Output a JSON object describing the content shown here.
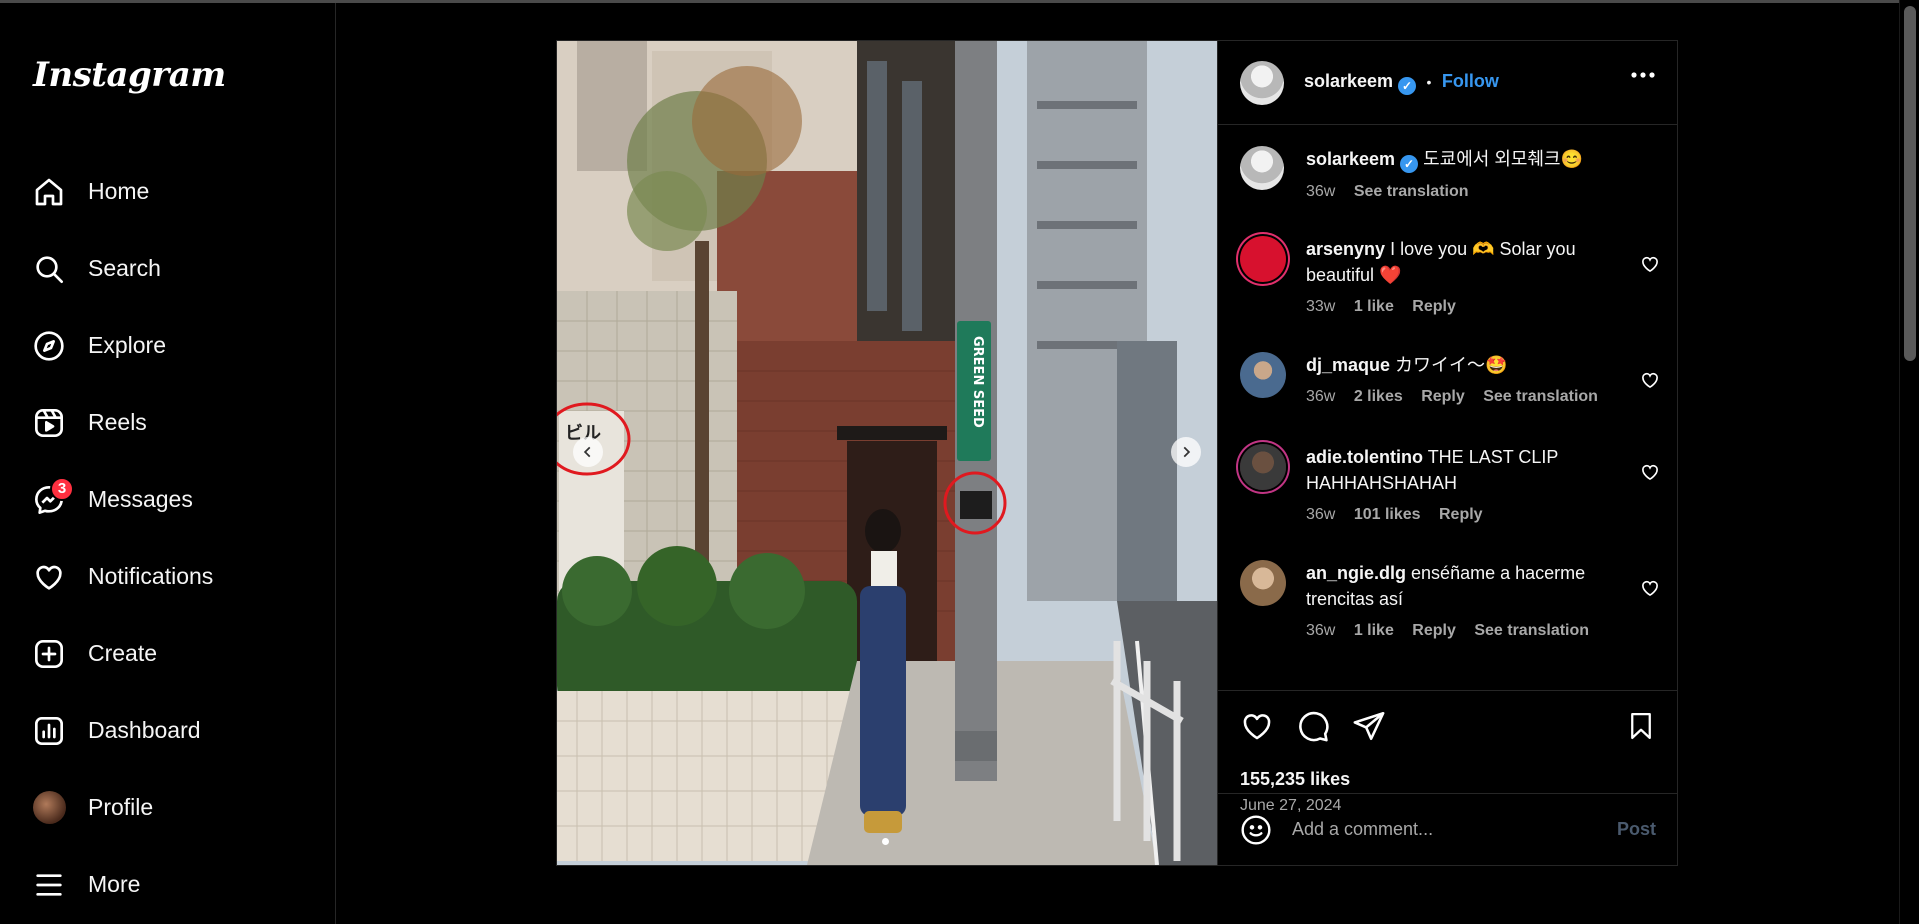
{
  "app": {
    "logo_text": "Instagram"
  },
  "sidebar": {
    "items": [
      {
        "label": "Home",
        "icon": "home-icon"
      },
      {
        "label": "Search",
        "icon": "search-icon"
      },
      {
        "label": "Explore",
        "icon": "compass-icon"
      },
      {
        "label": "Reels",
        "icon": "reels-icon"
      },
      {
        "label": "Messages",
        "icon": "messenger-icon",
        "badge": "3"
      },
      {
        "label": "Notifications",
        "icon": "heart-icon"
      },
      {
        "label": "Create",
        "icon": "plus-square-icon"
      },
      {
        "label": "Dashboard",
        "icon": "chart-icon"
      },
      {
        "label": "Profile",
        "icon": "avatar"
      },
      {
        "label": "More",
        "icon": "hamburger-icon"
      }
    ]
  },
  "post": {
    "author": "solarkeem",
    "follow_label": "Follow",
    "separator": "•",
    "caption": {
      "user": "solarkeem",
      "text": "도쿄에서 외모췌크😊",
      "age": "36w",
      "translate": "See translation"
    },
    "comments": [
      {
        "user": "arsenyny",
        "text": "I love you 🫶 Solar you beautiful ❤️",
        "age": "33w",
        "likes": "1 like",
        "reply": "Reply",
        "translate": "",
        "avatar_color": "#d7112e"
      },
      {
        "user": "dj_maque",
        "text": "カワイイ〜🤩",
        "age": "36w",
        "likes": "2 likes",
        "reply": "Reply",
        "translate": "See translation",
        "avatar_color": "#4a6a8f"
      },
      {
        "user": "adie.tolentino",
        "text": "THE LAST CLIP HAHHAHSHAHAH",
        "age": "36w",
        "likes": "101 likes",
        "reply": "Reply",
        "translate": "",
        "avatar_color": "#3a3a3a"
      },
      {
        "user": "an_ngie.dlg",
        "text": "enséñame a hacerme trencitas así",
        "age": "36w",
        "likes": "1 like",
        "reply": "Reply",
        "translate": "See translation",
        "avatar_color": "#8a6a4a"
      }
    ],
    "likes_count": "155,235 likes",
    "date": "June 27, 2024",
    "add_comment_placeholder": "Add a comment...",
    "post_label": "Post"
  },
  "photo": {
    "sign_text": "ビル",
    "pole_sign": "GREEN SEED",
    "colors": {
      "sky": "#c8d3dc",
      "brick": "#8a4a3a",
      "pole": "#7d7f82",
      "circle": "#e0191f"
    }
  },
  "colors": {
    "accent": "#3797f0",
    "badge": "#ff3040"
  }
}
